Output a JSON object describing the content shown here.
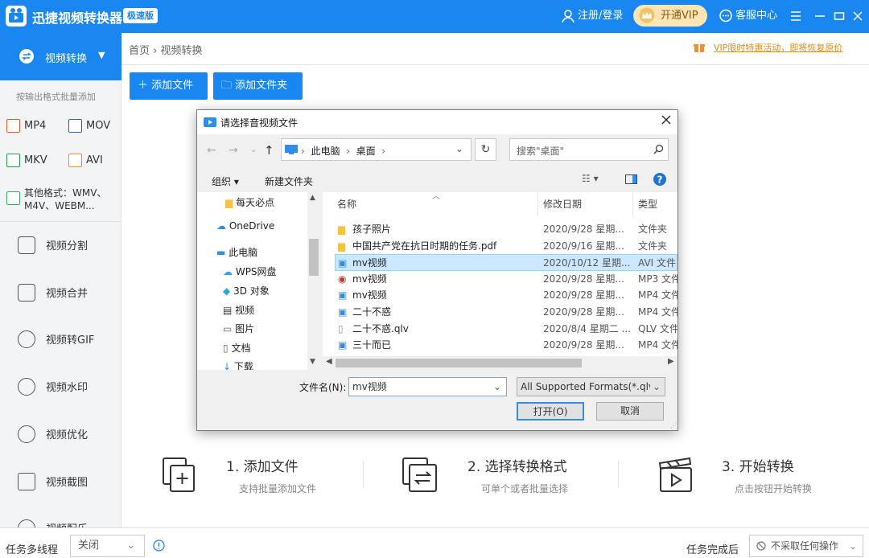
{
  "app": {
    "title": "迅捷视频转换器",
    "badge": "极速版"
  },
  "titlebar": {
    "login": "注册/登录",
    "vip": "开通VIP",
    "service": "客服中心"
  },
  "sidebar": {
    "active": "视频转换",
    "hint": "按输出格式批量添加",
    "formats": [
      "MP4",
      "MOV",
      "MKV",
      "AVI"
    ],
    "other_formats": "其他格式：WMV、M4V、WEBM...",
    "items": [
      "视频分割",
      "视频合并",
      "视频转GIF",
      "视频水印",
      "视频优化",
      "视频截图",
      "视频配乐"
    ]
  },
  "breadcrumb": {
    "home": "首页",
    "sep": "›",
    "current": "视频转换"
  },
  "promo": "VIP限时特惠活动，即将恢复原价",
  "toolbar": {
    "add_file": "添加文件",
    "add_folder": "添加文件夹"
  },
  "steps": [
    {
      "title": "1. 添加文件",
      "sub": "支持批量添加文件"
    },
    {
      "title": "2. 选择转换格式",
      "sub": "可单个或者批量选择"
    },
    {
      "title": "3. 开始转换",
      "sub": "点击按钮开始转换"
    }
  ],
  "bottom": {
    "multi_task": "任务多线程",
    "multi_value": "关闭",
    "done_label": "任务完成后",
    "done_value": "不采取任何操作"
  },
  "dialog": {
    "title": "请选择音视频文件",
    "path": [
      "此电脑",
      "桌面"
    ],
    "search_placeholder": "搜索\"桌面\"",
    "organize": "组织 ▾",
    "new_folder": "新建文件夹",
    "tree": [
      "每天必点",
      "OneDrive",
      "此电脑",
      "WPS网盘",
      "3D 对象",
      "视频",
      "图片",
      "文档",
      "下载"
    ],
    "columns": {
      "name": "名称",
      "date": "修改日期",
      "type": "类型"
    },
    "files": [
      {
        "name": "孩子照片",
        "date": "2020/9/28 星期...",
        "type": "文件夹"
      },
      {
        "name": "中国共产党在抗日时期的任务.pdf",
        "date": "2020/9/16 星期...",
        "type": "文件夹"
      },
      {
        "name": "mv视频",
        "date": "2020/10/12 星期...",
        "type": "AVI 文件"
      },
      {
        "name": "mv视频",
        "date": "2020/9/28 星期...",
        "type": "MP3 文件"
      },
      {
        "name": "mv视频",
        "date": "2020/9/28 星期...",
        "type": "MP4 文件"
      },
      {
        "name": "二十不惑",
        "date": "2020/9/28 星期...",
        "type": "MP4 文件"
      },
      {
        "name": "二十不惑.qlv",
        "date": "2020/8/4 星期二 ...",
        "type": "QLV 文件"
      },
      {
        "name": "三十而已",
        "date": "2020/9/28 星期...",
        "type": "MP4 文件"
      }
    ],
    "filename_label": "文件名(N):",
    "filename_value": "mv视频",
    "format_filter": "All Supported Formats(*.qlv;",
    "open": "打开(O)",
    "cancel": "取消"
  }
}
